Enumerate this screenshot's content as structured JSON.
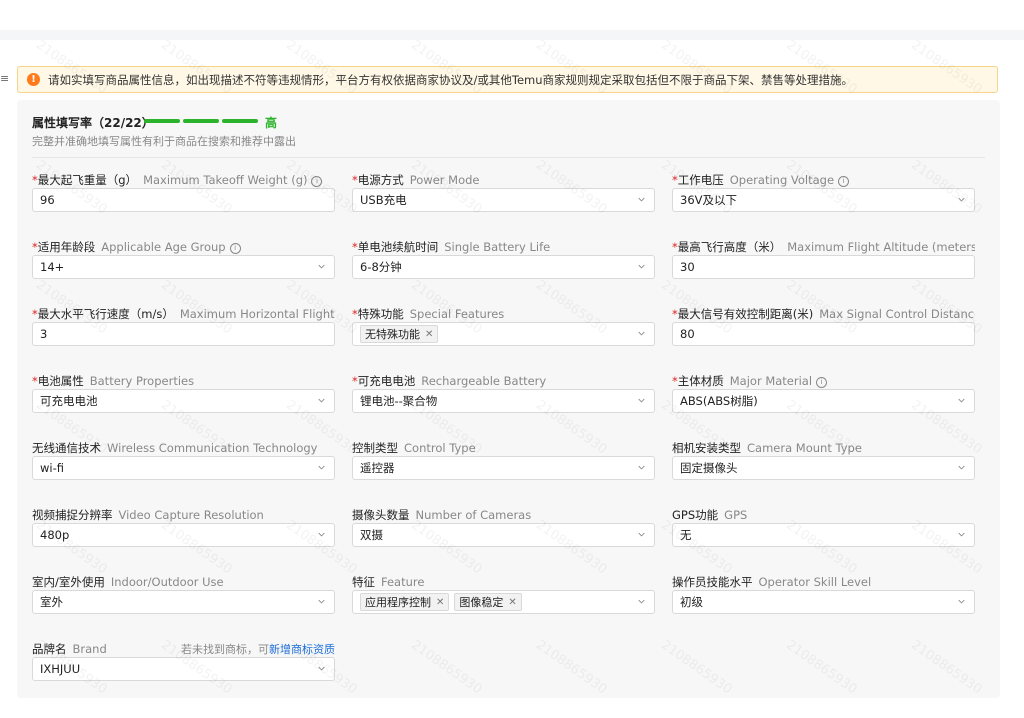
{
  "notice": {
    "icon": "exclamation-icon",
    "text": "请如实填写商品属性信息，如出现描述不符等违规情形，平台方有权依据商家协议及/或其他Temu商家规则规定采取包括但不限于商品下架、禁售等处理措施。"
  },
  "completion": {
    "title": "属性填写率（22/22）",
    "level": "高",
    "description": "完整并准确地填写属性有利于商品在搜索和推荐中露出",
    "color": "#2bb32b"
  },
  "fields": [
    {
      "required": true,
      "label": "最大起飞重量（g）",
      "label_en": "Maximum Takeoff Weight (g)",
      "info": true,
      "kind": "text",
      "value": "96"
    },
    {
      "required": true,
      "label": "电源方式",
      "label_en": "Power Mode",
      "info": false,
      "kind": "select",
      "value": "USB充电"
    },
    {
      "required": true,
      "label": "工作电压",
      "label_en": "Operating Voltage",
      "info": true,
      "kind": "select",
      "value": "36V及以下"
    },
    {
      "required": true,
      "label": "适用年龄段",
      "label_en": "Applicable Age Group",
      "info": true,
      "kind": "select",
      "value": "14+"
    },
    {
      "required": true,
      "label": "单电池续航时间",
      "label_en": "Single Battery Life",
      "info": false,
      "kind": "select",
      "value": "6-8分钟"
    },
    {
      "required": true,
      "label": "最高飞行高度（米）",
      "label_en": "Maximum Flight Altitude (meters)",
      "info": false,
      "kind": "text",
      "value": "30"
    },
    {
      "required": true,
      "label": "最大水平飞行速度（m/s）",
      "label_en": "Maximum Horizontal Flight Spe...",
      "info": false,
      "kind": "text",
      "value": "3"
    },
    {
      "required": true,
      "label": "特殊功能",
      "label_en": "Special Features",
      "info": false,
      "kind": "tags",
      "tags": [
        "无特殊功能"
      ]
    },
    {
      "required": true,
      "label": "最大信号有效控制距离(米)",
      "label_en": "Max Signal Control Distance (M)",
      "info": false,
      "kind": "text",
      "value": "80"
    },
    {
      "required": true,
      "label": "电池属性",
      "label_en": "Battery Properties",
      "info": false,
      "kind": "select",
      "value": "可充电电池"
    },
    {
      "required": true,
      "label": "可充电电池",
      "label_en": "Rechargeable Battery",
      "info": false,
      "kind": "select",
      "value": "锂电池--聚合物"
    },
    {
      "required": true,
      "label": "主体材质",
      "label_en": "Major Material",
      "info": true,
      "kind": "select",
      "value": "ABS(ABS树脂)"
    },
    {
      "required": false,
      "label": "无线通信技术",
      "label_en": "Wireless Communication Technology",
      "info": false,
      "kind": "select",
      "value": "wi-fi"
    },
    {
      "required": false,
      "label": "控制类型",
      "label_en": "Control Type",
      "info": false,
      "kind": "select",
      "value": "遥控器"
    },
    {
      "required": false,
      "label": "相机安装类型",
      "label_en": "Camera Mount Type",
      "info": false,
      "kind": "select",
      "value": "固定摄像头"
    },
    {
      "required": false,
      "label": "视频捕捉分辨率",
      "label_en": "Video Capture Resolution",
      "info": false,
      "kind": "select",
      "value": "480p"
    },
    {
      "required": false,
      "label": "摄像头数量",
      "label_en": "Number of Cameras",
      "info": false,
      "kind": "select",
      "value": "双摄"
    },
    {
      "required": false,
      "label": "GPS功能",
      "label_en": "GPS",
      "info": false,
      "kind": "select",
      "value": "无"
    },
    {
      "required": false,
      "label": "室内/室外使用",
      "label_en": "Indoor/Outdoor Use",
      "info": false,
      "kind": "select",
      "value": "室外"
    },
    {
      "required": false,
      "label": "特征",
      "label_en": "Feature",
      "info": false,
      "kind": "tags",
      "tags": [
        "应用程序控制",
        "图像稳定"
      ]
    },
    {
      "required": false,
      "label": "操作员技能水平",
      "label_en": "Operator Skill Level",
      "info": false,
      "kind": "select",
      "value": "初级"
    },
    {
      "required": false,
      "label": "品牌名",
      "label_en": "Brand",
      "info": false,
      "kind": "select",
      "value": "IXHJUU",
      "hint": "若未找到商标，可",
      "hint_link": "新增商标资质"
    }
  ],
  "watermark": "2108865930"
}
